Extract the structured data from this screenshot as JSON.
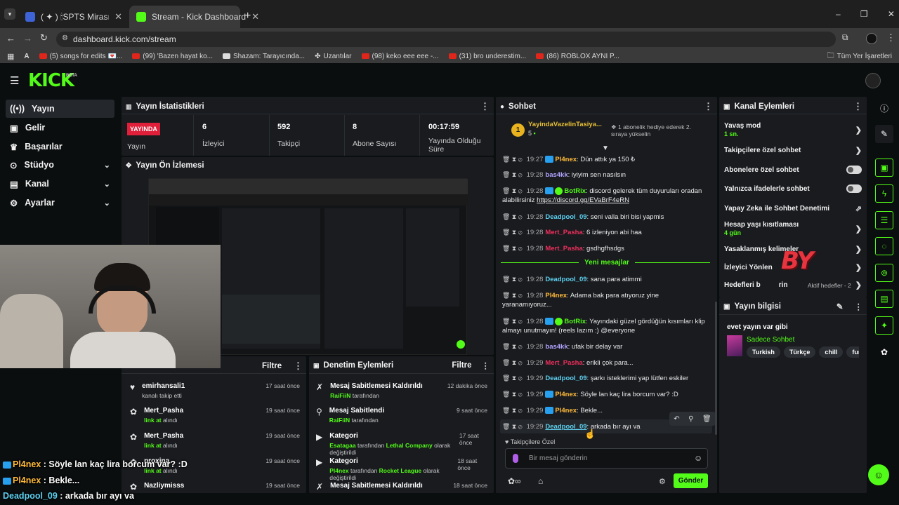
{
  "browser": {
    "tabs": [
      {
        "label": "( ✦ ) 🕯SPTS Mirası - Roblox"
      },
      {
        "label": "Stream - Kick Dashboard"
      }
    ],
    "url": "dashboard.kick.com/stream",
    "bookmarks": [
      "(5) songs for edits 💌...",
      "(99) 'Bazen hayat ko...",
      "Shazam: Tarayıcında...",
      "Uzantılar",
      "(98) keko eee eee -...",
      "(31) bro underestim...",
      "(86) ROBLOX AYNI P..."
    ],
    "all_bookmarks": "Tüm Yer İşaretleri"
  },
  "brand": {
    "logo": "KICK",
    "beta": "BETA"
  },
  "sidebar": {
    "items": [
      {
        "label": "Yayın"
      },
      {
        "label": "Gelir"
      },
      {
        "label": "Başarılar"
      },
      {
        "label": "Stüdyo"
      },
      {
        "label": "Kanal"
      },
      {
        "label": "Ayarlar"
      }
    ]
  },
  "stats": {
    "title": "Yayın İstatistikleri",
    "live_badge": "YAYINDA",
    "live_label": "Yayın",
    "items": [
      {
        "value": "6",
        "label": "İzleyici"
      },
      {
        "value": "592",
        "label": "Takipçi"
      },
      {
        "value": "8",
        "label": "Abone Sayısı"
      },
      {
        "value": "00:17:59",
        "label": "Yayında Olduğu Süre"
      }
    ]
  },
  "preview": {
    "title": "Yayın Ön İzlemesi"
  },
  "activity": {
    "filter": "Filtre",
    "items": [
      {
        "name": "emirhansali1",
        "sub": "kanalı takip etti",
        "sub_hl": "",
        "ago": "17 saat önce"
      },
      {
        "name": "Mert_Pasha",
        "sub": "alındı",
        "sub_hl": "link at",
        "ago": "19 saat önce"
      },
      {
        "name": "Mert_Pasha",
        "sub": "alındı",
        "sub_hl": "link at",
        "ago": "19 saat önce"
      },
      {
        "name": "proxina",
        "sub": "alındı",
        "sub_hl": "link at",
        "ago": "19 saat önce"
      },
      {
        "name": "Nazliymisss",
        "sub": "",
        "sub_hl": "",
        "ago": "19 saat önce"
      }
    ]
  },
  "moderation": {
    "title": "Denetim Eylemleri",
    "filter": "Filtre",
    "items": [
      {
        "title": "Mesaj Sabitlemesi Kaldırıldı",
        "actor": "RaiFiiN",
        "rest": "tarafından",
        "ago": "12 dakika önce"
      },
      {
        "title": "Mesaj Sabitlendi",
        "actor": "RaiFiiN",
        "rest": "tarafından",
        "ago": "9 saat önce"
      },
      {
        "title": "Kategori",
        "actor": "Esatagaa",
        "rest": "tarafından",
        "game": "Lethal Company",
        "rest2": "olarak değiştirildi",
        "ago": "17 saat önce"
      },
      {
        "title": "Kategori",
        "actor": "Pl4nex",
        "rest": "tarafından",
        "game": "Rocket League",
        "rest2": "olarak değiştirildi",
        "ago": "18 saat önce"
      },
      {
        "title": "Mesaj Sabitlemesi Kaldırıldı",
        "actor": "",
        "rest": "",
        "ago": "18 saat önce"
      }
    ]
  },
  "chat": {
    "title": "Sohbet",
    "top_gifter": {
      "name": "YayindaVazelinTasiya...",
      "count": "5",
      "rank": "1"
    },
    "promo": "1 abonelik hediye ederek 2. sıraya yükselin",
    "divider": "Yeni mesajlar",
    "messages": [
      {
        "time": "19:27",
        "user": "Pl4nex",
        "text": "Dün attık ya 150 ₺"
      },
      {
        "time": "19:28",
        "user": "bas4kk",
        "text": "iyiyim sen nasılsın"
      },
      {
        "time": "19:28",
        "user": "BotRix",
        "text": "discord gelerek tüm duyuruları oradan alabilirsiniz",
        "link": "https://discord.gg/EVaBrF4eRN"
      },
      {
        "time": "19:28",
        "user": "Deadpool_09",
        "text": "seni valla biri bisi yapmis"
      },
      {
        "time": "19:28",
        "user": "Mert_Pasha",
        "text": "6 izleniyon abi haa"
      },
      {
        "time": "19:28",
        "user": "Mert_Pasha",
        "text": "gsdhgfhsdgs"
      },
      {
        "time": "19:28",
        "user": "Deadpool_09",
        "text": "sana para atimmi"
      },
      {
        "time": "19:28",
        "user": "Pl4nex",
        "text": "Adama bak para atıyoruz yine yaranamıyoruz..."
      },
      {
        "time": "19:28",
        "user": "BotRix",
        "text": "Yayındaki güzel gördüğün kısımları klip almayı unutmayın! (reels lazım :) @everyone"
      },
      {
        "time": "19:28",
        "user": "bas4kk",
        "text": "ufak bir delay var"
      },
      {
        "time": "19:29",
        "user": "Mert_Pasha",
        "text": "erikli çok para..."
      },
      {
        "time": "19:29",
        "user": "Deadpool_09",
        "text": "şarkı isteklerimi yap lütfen eskiler"
      },
      {
        "time": "19:29",
        "user": "Pl4nex",
        "text": "Söyle lan kaç lira borcum var? :D"
      },
      {
        "time": "19:29",
        "user": "Pl4nex",
        "text": "Bekle..."
      },
      {
        "time": "19:29",
        "user": "Deadpool_09",
        "text": "arkada bır ayı va"
      }
    ],
    "followers_only": "Takipçilere Özel",
    "input_placeholder": "Bir mesaj gönderin",
    "send": "Gönder"
  },
  "channel_actions": {
    "title": "Kanal Eylemleri",
    "slow_mode": "Yavaş mod",
    "slow_value": "1 sn.",
    "followers_chat": "Takipçilere özel sohbet",
    "subs_chat": "Abonelere özel sohbet",
    "emote_chat": "Yalnızca ifadelerle sohbet",
    "ai_mod": "Yapay Zeka ile Sohbet Denetimi",
    "age_limit": "Hesap yaşı kısıtlaması",
    "age_value": "4 gün",
    "banned_words": "Yasaklanmış kelimeler",
    "viewer_dir": "İzleyici Yönlen",
    "goals": "Hedefleri b",
    "goals_b": "rin",
    "goals_active": "Aktif hedefler - 2"
  },
  "stream_info": {
    "title": "Yayın bilgisi",
    "stream_title": "evet yayın var gibi",
    "category": "Sadece Sohbet",
    "tags": [
      "Turkish",
      "Türkçe",
      "chill",
      "funny"
    ]
  },
  "overlay": {
    "sticker": "BY",
    "lines": [
      {
        "user": "Pl4nex",
        "text": " : Söyle lan kaç lira borcum var? :D"
      },
      {
        "user": "Pl4nex",
        "text": " : Bekle..."
      },
      {
        "user": "Deadpool_09",
        "text": " : arkada bır ayı va"
      }
    ]
  },
  "colors": {
    "accent": "#53fc18",
    "live": "#e0203a",
    "panel": "#191b1f"
  }
}
